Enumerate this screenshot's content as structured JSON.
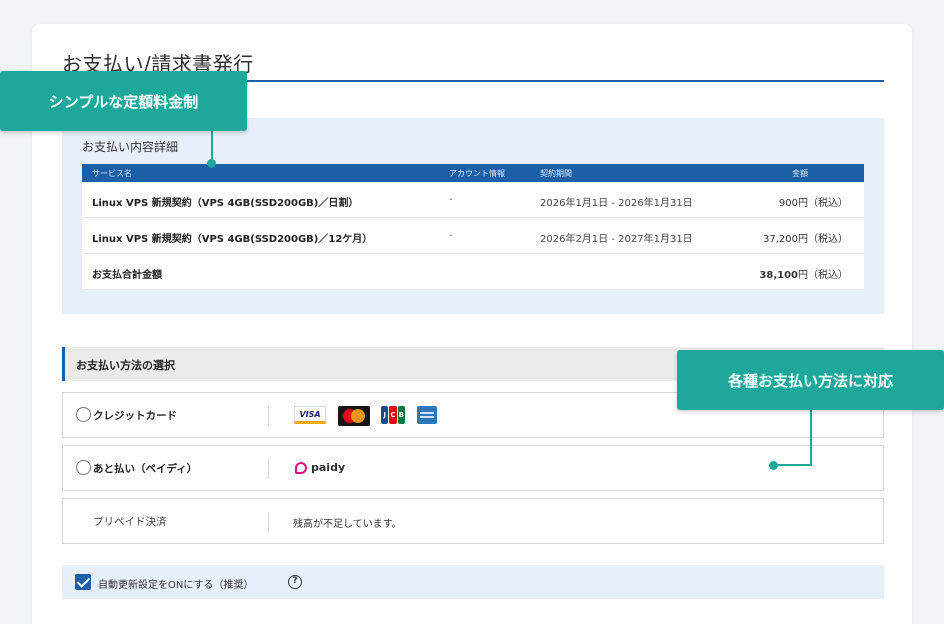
{
  "page": {
    "title": "お支払い/請求書発行"
  },
  "callouts": {
    "flat_rate": "シンプルな定額料金制",
    "methods": "各種お支払い方法に対応"
  },
  "detail": {
    "heading": "お支払い内容詳細",
    "columns": {
      "service": "サービス名",
      "account": "アカウント情報",
      "period": "契約期間",
      "amount": "金額"
    },
    "rows": [
      {
        "service": "Linux VPS 新規契約（VPS 4GB(SSD200GB)／日割）",
        "account": "-",
        "period": "2026年1月1日 - 2026年1月31日",
        "amount": "900円（税込）"
      },
      {
        "service": "Linux VPS 新規契約（VPS 4GB(SSD200GB)／12ケ月）",
        "account": "-",
        "period": "2026年2月1日 - 2027年1月31日",
        "amount": "37,200円（税込）"
      }
    ],
    "total": {
      "label": "お支払合計金額",
      "value": "38,100",
      "suffix": "円（税込）"
    }
  },
  "payment": {
    "section_title": "お支払い方法の選択",
    "options": [
      {
        "label": "クレジットカード",
        "brands": [
          "VISA",
          "Mastercard",
          "JCB",
          "AMEX"
        ]
      },
      {
        "label": "あと払い（ペイディ）",
        "brand": "paidy"
      },
      {
        "label": "プリペイド決済",
        "message": "残高が不足しています。"
      }
    ]
  },
  "auto_renew": {
    "label": "自動更新設定をONにする（推奨）",
    "checked": true,
    "help": "?"
  },
  "colors": {
    "accent_blue": "#1d5fa6",
    "callout_teal": "#1ea79b",
    "panel_blue": "#e7f0fa"
  }
}
